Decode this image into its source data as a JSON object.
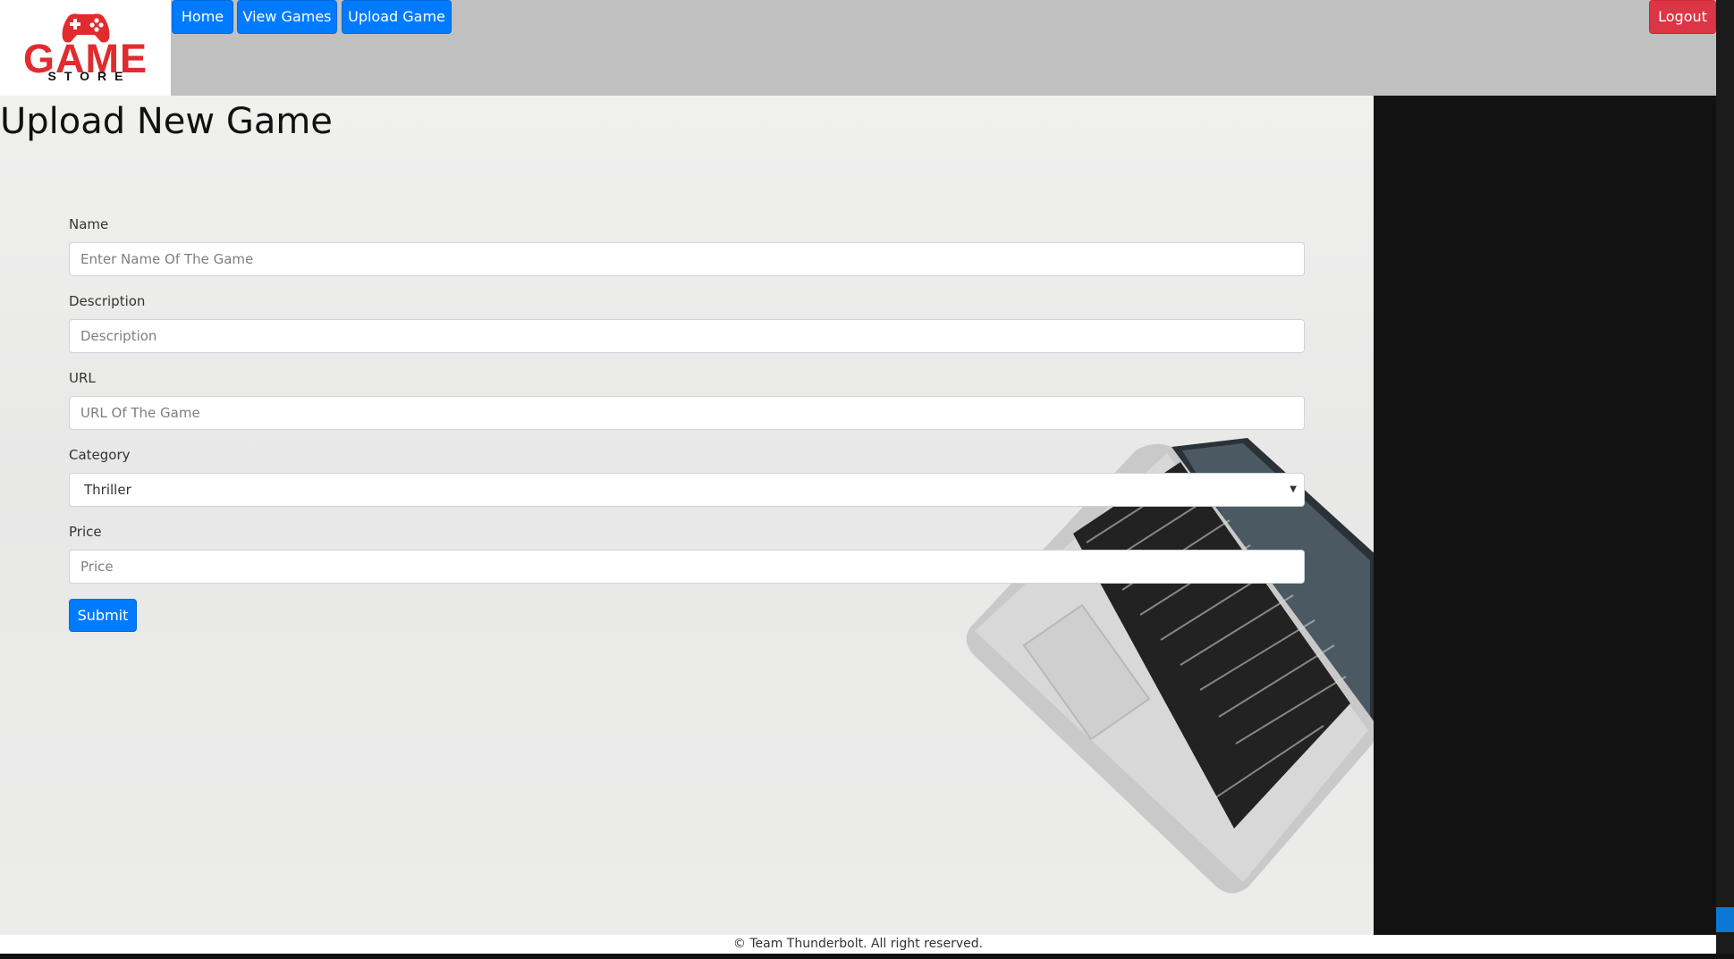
{
  "brand": {
    "logo_word": "GAME",
    "logo_subword": "STORE",
    "logo_color": "#e12b2f"
  },
  "nav": {
    "home": "Home",
    "view_games": "View Games",
    "upload_game": "Upload Game",
    "logout": "Logout"
  },
  "page": {
    "title": "Upload New Game"
  },
  "form": {
    "name_label": "Name",
    "name_placeholder": "Enter Name Of The Game",
    "description_label": "Description",
    "description_placeholder": "Description",
    "url_label": "URL",
    "url_placeholder": "URL Of The Game",
    "category_label": "Category",
    "category_selected": "Thriller",
    "price_label": "Price",
    "price_placeholder": "Price",
    "submit_label": "Submit"
  },
  "footer": {
    "text": "© Team Thunderbolt. All right reserved."
  },
  "colors": {
    "primary": "#007bff",
    "danger": "#dc3545",
    "topbar": "#c0c0c0",
    "dark_panel": "#121212"
  },
  "icons": {
    "logo": "gamepad-icon",
    "select_caret": "caret-down-icon"
  }
}
